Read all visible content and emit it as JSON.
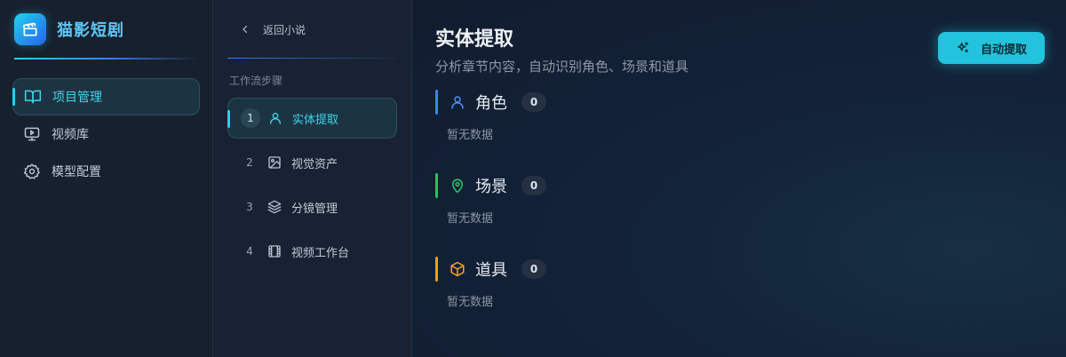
{
  "sidebar": {
    "brand": {
      "name": "猫影短剧",
      "logo_icon": "clapperboard-icon"
    },
    "items": [
      {
        "label": "项目管理",
        "icon": "book-open-icon",
        "active": true
      },
      {
        "label": "视频库",
        "icon": "monitor-play-icon",
        "active": false
      },
      {
        "label": "模型配置",
        "icon": "gear-icon",
        "active": false
      }
    ]
  },
  "workflow": {
    "back_label": "返回小说",
    "title": "工作流步骤",
    "steps": [
      {
        "num": "1",
        "label": "实体提取",
        "icon": "user-icon",
        "active": true
      },
      {
        "num": "2",
        "label": "视觉资产",
        "icon": "image-icon",
        "active": false
      },
      {
        "num": "3",
        "label": "分镜管理",
        "icon": "layers-icon",
        "active": false
      },
      {
        "num": "4",
        "label": "视频工作台",
        "icon": "film-icon",
        "active": false
      }
    ]
  },
  "main": {
    "title": "实体提取",
    "subtitle": "分析章节内容，自动识别角色、场景和道具",
    "auto_button_label": "自动提取",
    "sections": [
      {
        "title": "角色",
        "count": "0",
        "empty_text": "暂无数据",
        "icon": "user-icon",
        "color": "#3b82f6"
      },
      {
        "title": "场景",
        "count": "0",
        "empty_text": "暂无数据",
        "icon": "map-pin-icon",
        "color": "#22c55e"
      },
      {
        "title": "道具",
        "count": "0",
        "empty_text": "暂无数据",
        "icon": "box-icon",
        "color": "#f59e0b"
      }
    ]
  },
  "colors": {
    "accent": "#22d3ee",
    "background": "#0f1a29"
  }
}
